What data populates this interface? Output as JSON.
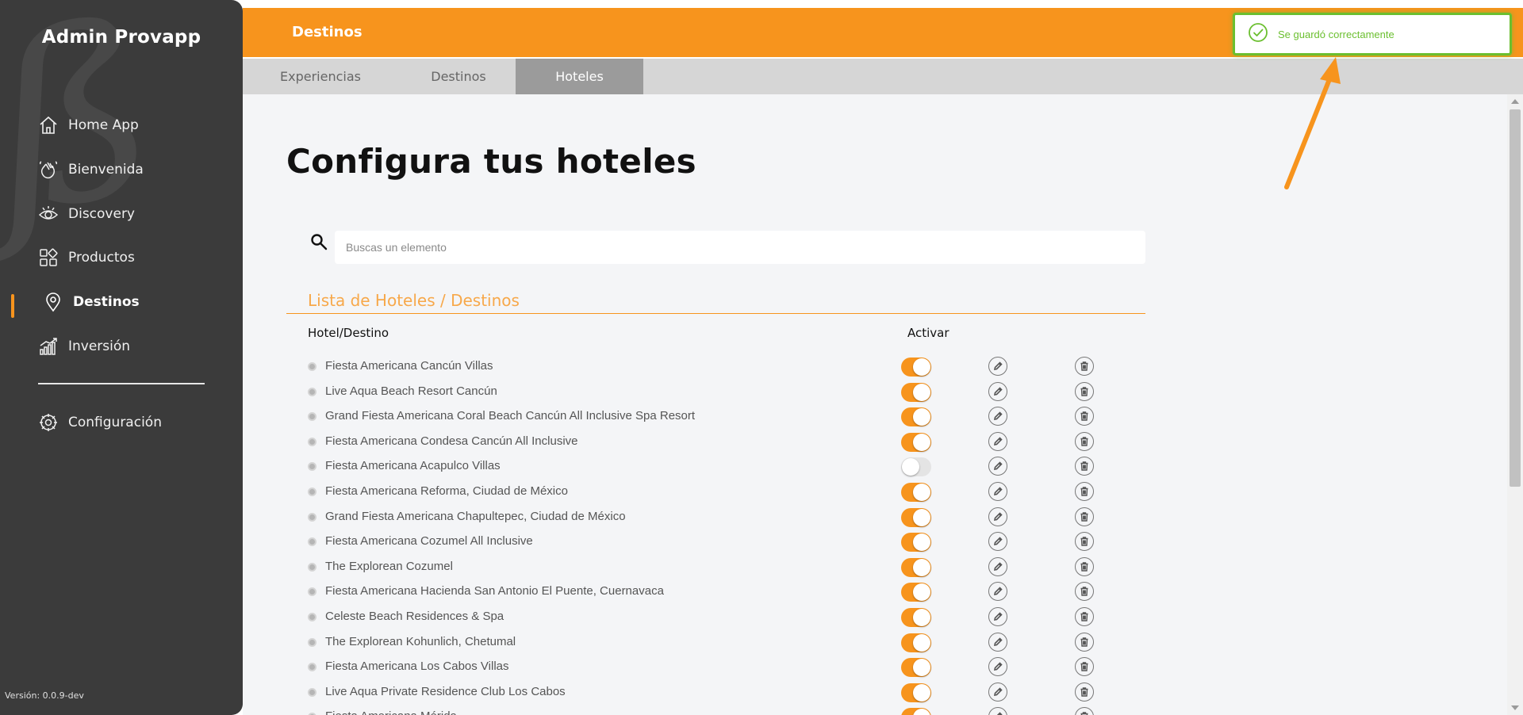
{
  "sidebar": {
    "app_title": "Admin Provapp",
    "items": [
      {
        "label": "Home App",
        "icon": "home-icon"
      },
      {
        "label": "Bienvenida",
        "icon": "hand-wave-icon"
      },
      {
        "label": "Discovery",
        "icon": "eye-icon"
      },
      {
        "label": "Productos",
        "icon": "grid-icon"
      },
      {
        "label": "Destinos",
        "icon": "map-pin-icon",
        "active": true
      },
      {
        "label": "Inversión",
        "icon": "bar-chart-icon"
      }
    ],
    "config_label": "Configuración",
    "version": "Versión: 0.0.9-dev"
  },
  "header": {
    "title": "Destinos",
    "tabs": [
      {
        "label": "Experiencias"
      },
      {
        "label": "Destinos"
      },
      {
        "label": "Hoteles",
        "active": true
      }
    ]
  },
  "main": {
    "page_title": "Configura tus hoteles",
    "search": {
      "placeholder": "Buscas un elemento",
      "value": ""
    },
    "list_title": "Lista de Hoteles / Destinos",
    "columns": {
      "name": "Hotel/Destino",
      "activate": "Activar"
    },
    "rows": [
      {
        "name": "Fiesta Americana Cancún Villas",
        "active": true
      },
      {
        "name": "Live Aqua Beach Resort Cancún",
        "active": true
      },
      {
        "name": "Grand Fiesta Americana Coral Beach Cancún All Inclusive Spa Resort",
        "active": true
      },
      {
        "name": "Fiesta Americana Condesa Cancún All Inclusive",
        "active": true
      },
      {
        "name": "Fiesta Americana Acapulco Villas",
        "active": false
      },
      {
        "name": "Fiesta Americana Reforma, Ciudad de México",
        "active": true
      },
      {
        "name": "Grand Fiesta Americana Chapultepec, Ciudad de México",
        "active": true
      },
      {
        "name": "Fiesta Americana Cozumel All Inclusive",
        "active": true
      },
      {
        "name": "The Explorean Cozumel",
        "active": true
      },
      {
        "name": "Fiesta Americana Hacienda San Antonio El Puente, Cuernavaca",
        "active": true
      },
      {
        "name": "Celeste Beach Residences & Spa",
        "active": true
      },
      {
        "name": "The Explorean Kohunlich, Chetumal",
        "active": true
      },
      {
        "name": "Fiesta Americana Los Cabos Villas",
        "active": true
      },
      {
        "name": "Live Aqua Private Residence Club Los Cabos",
        "active": true
      },
      {
        "name": "Fiesta Americana Mérida",
        "active": true
      }
    ]
  },
  "toast": {
    "message": "Se guardó correctamente",
    "icon": "check-circle-icon"
  },
  "colors": {
    "accent": "#f7941d",
    "sidebar_bg": "#3b3b3b",
    "success": "#6bbf2f"
  }
}
